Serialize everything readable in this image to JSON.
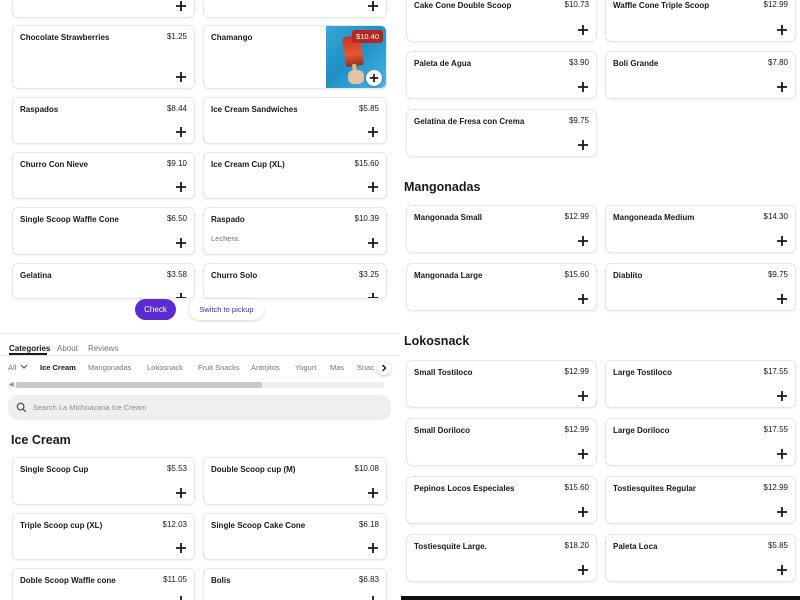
{
  "left_top_items": [
    {
      "name": "Chocolate Strawberries",
      "price": "$1.25"
    },
    {
      "name": "Chamango",
      "price": "$10.40"
    },
    {
      "name": "Raspados",
      "price": "$8.44"
    },
    {
      "name": "Ice Cream Sandwiches",
      "price": "$5.85"
    },
    {
      "name": "Churro Con Nieve",
      "price": "$9.10"
    },
    {
      "name": "Ice Cream Cup (XL)",
      "price": "$15.60"
    },
    {
      "name": "Single Scoop Waffle Cone",
      "price": "$6.50"
    },
    {
      "name": "Raspado",
      "price": "$10.39",
      "description": "Lechera."
    },
    {
      "name": "Gelatina",
      "price": "$3.58"
    },
    {
      "name": "Churro Solo",
      "price": "$3.25"
    }
  ],
  "actions": {
    "check": "Check",
    "pickup": "Switch to pickup"
  },
  "tabs": {
    "categories": "Categories",
    "about": "About",
    "reviews": "Reviews"
  },
  "category_nav": {
    "all": "All",
    "items": [
      "Ice Cream",
      "Mangonadas",
      "Lokosnack",
      "Fruit Snacks",
      "Antojitos",
      "Yogurt",
      "Mas",
      "Snac"
    ]
  },
  "search": {
    "placeholder": "Search La Michoacana Ice Cream"
  },
  "ice_cream": {
    "title": "Ice Cream",
    "items": [
      {
        "name": "Single Scoop Cup",
        "price": "$5.53"
      },
      {
        "name": "Double Scoop cup (M)",
        "price": "$10.08"
      },
      {
        "name": "Triple Scoop cup (XL)",
        "price": "$12.03"
      },
      {
        "name": "Single Scoop Cake Cone",
        "price": "$6.18"
      },
      {
        "name": "Doble Scoop Waffle cone",
        "price": "$11.05"
      },
      {
        "name": "Bolis",
        "price": "$6.83"
      }
    ]
  },
  "right_top_items": [
    {
      "name": "Cake Cone Double Scoop",
      "price": "$10.73"
    },
    {
      "name": "Waffle Cone Triple Scoop",
      "price": "$12.99"
    },
    {
      "name": "Paleta de Agua",
      "price": "$3.90"
    },
    {
      "name": "Boli Grande",
      "price": "$7.80"
    },
    {
      "name": "Gelatina de Fresa con Crema",
      "price": "$9.75"
    }
  ],
  "mangonadas": {
    "title": "Mangonadas",
    "items": [
      {
        "name": "Mangonada Small",
        "price": "$12.99"
      },
      {
        "name": "Mangoneada Medium",
        "price": "$14.30"
      },
      {
        "name": "Mangonada Large",
        "price": "$15.60"
      },
      {
        "name": "Diablito",
        "price": "$9.75"
      }
    ]
  },
  "lokosnack": {
    "title": "Lokosnack",
    "items": [
      {
        "name": "Small Tostiloco",
        "price": "$12.99"
      },
      {
        "name": "Large Tostiloco",
        "price": "$17.55"
      },
      {
        "name": "Small Doriloco",
        "price": "$12.99"
      },
      {
        "name": "Large Doriloco",
        "price": "$17.55"
      },
      {
        "name": "Pepinos Locos Especiales",
        "price": "$15.60"
      },
      {
        "name": "Tostiesquites Regular",
        "price": "$12.99"
      },
      {
        "name": "Tostiesquite Large.",
        "price": "$18.20"
      },
      {
        "name": "Paleta Loca",
        "price": "$5.85"
      }
    ]
  },
  "colors": {
    "accent": "#5b2ad0",
    "link": "#3f2bb0",
    "badge": "#b8261f"
  }
}
